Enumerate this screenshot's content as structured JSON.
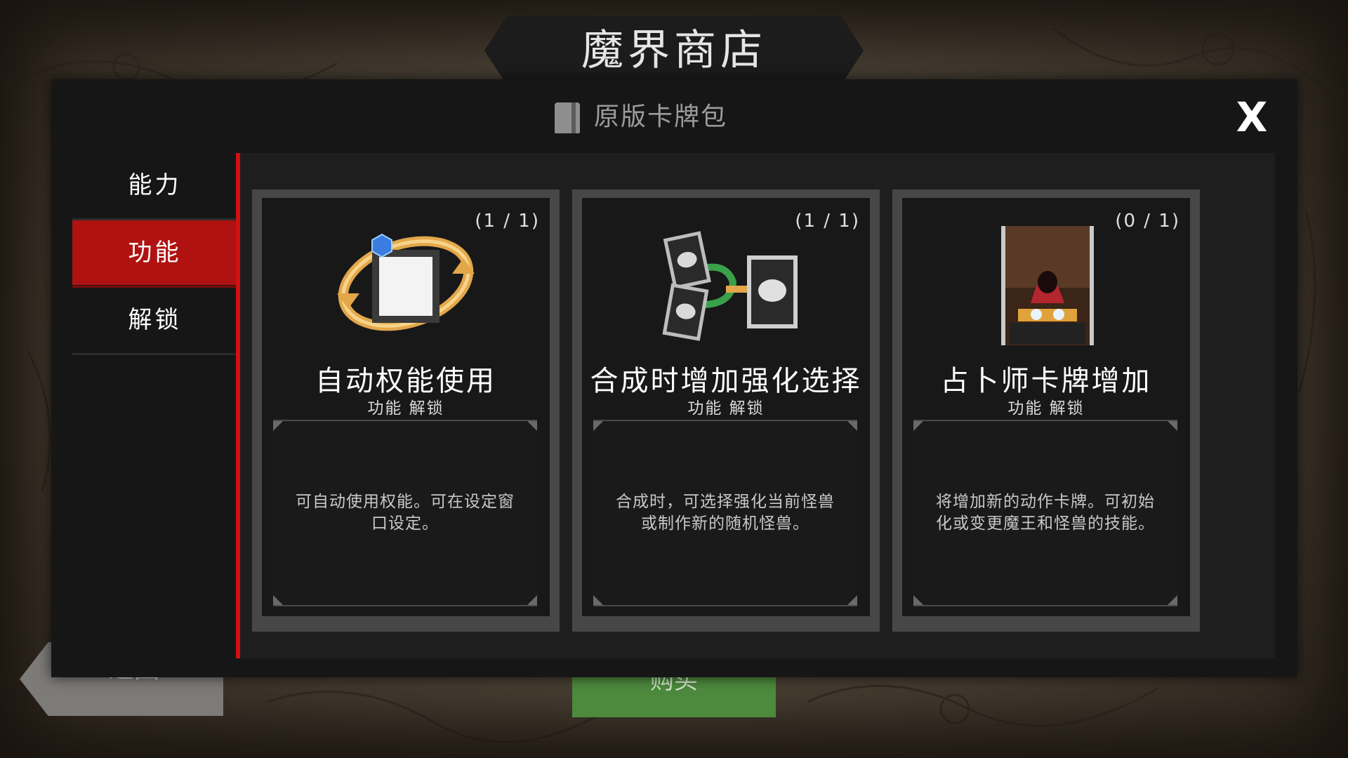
{
  "title": "魔界商店",
  "pack_label": "原版卡牌包",
  "close_label": "X",
  "sidebar": {
    "items": [
      {
        "label": "能力",
        "active": false
      },
      {
        "label": "功能",
        "active": true
      },
      {
        "label": "解锁",
        "active": false
      }
    ]
  },
  "bottom": {
    "back_label": "返回",
    "buy_label": "购买"
  },
  "cards": [
    {
      "count": "(1 / 1)",
      "title": "自动权能使用",
      "subtitle": "功能 解锁",
      "description": "可自动使用权能。可在设定窗口设定。",
      "art_icon": "auto-cycle-icon"
    },
    {
      "count": "(1 / 1)",
      "title": "合成时增加强化选择",
      "subtitle": "功能 解锁",
      "description": "合成时，可选择强化当前怪兽或制作新的随机怪兽。",
      "art_icon": "merge-cards-icon"
    },
    {
      "count": "(0 / 1)",
      "title": "占卜师卡牌增加",
      "subtitle": "功能 解锁",
      "description": "将增加新的动作卡牌。可初始化或变更魔王和怪兽的技能。",
      "art_icon": "fortune-teller-card-icon"
    }
  ],
  "colors": {
    "accent_red": "#d21010",
    "active_tab": "#b01212",
    "buy_green": "#4d8a3e",
    "panel_bg": "#161616"
  }
}
